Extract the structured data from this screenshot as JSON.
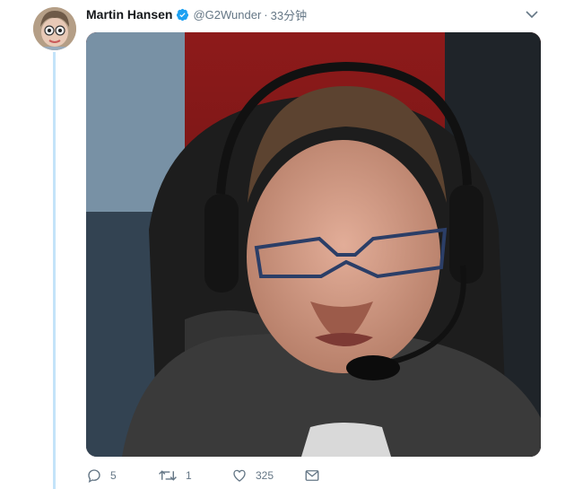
{
  "tweet": {
    "author_name": "Martin Hansen",
    "handle": "@G2Wunder",
    "separator": "·",
    "time": "33分钟",
    "verified": true
  },
  "media": {
    "icon": "photo",
    "colors": {
      "background_red": "#a51f1f",
      "chair": "#1e1e1e"
    }
  },
  "actions": {
    "reply_count": "5",
    "retweet_count": "1",
    "like_count": "325"
  },
  "colors": {
    "thread_line": "#c4e3f9",
    "verified": "#1da1f2",
    "muted": "#657786"
  }
}
